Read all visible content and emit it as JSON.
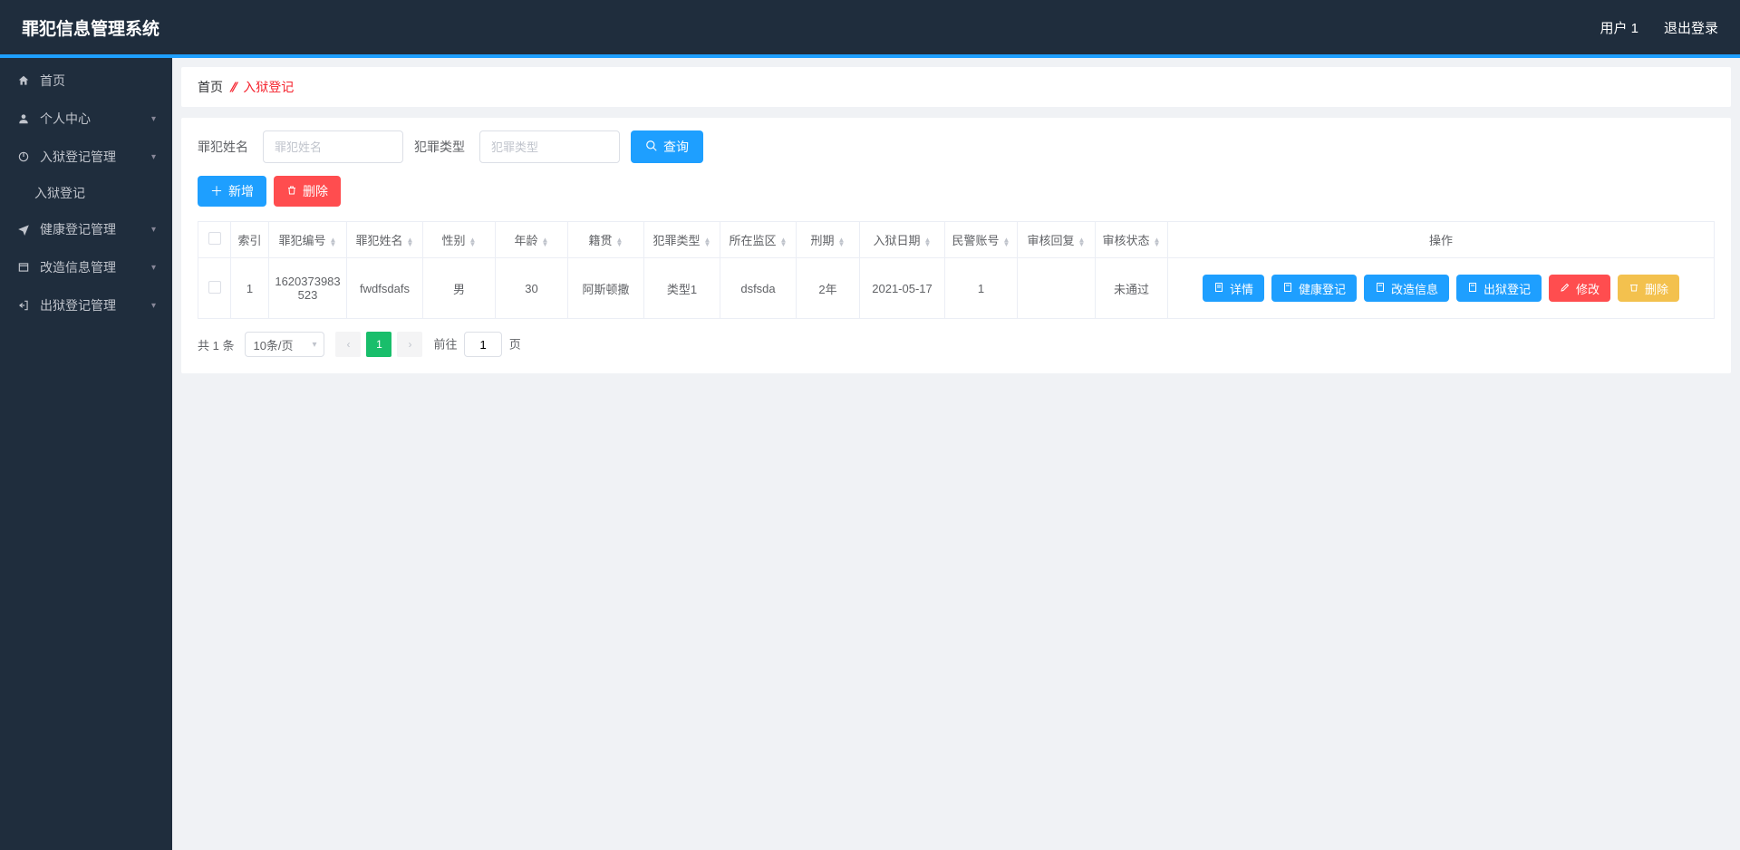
{
  "header": {
    "title": "罪犯信息管理系统",
    "user": "用户 1",
    "logout": "退出登录"
  },
  "sidebar": {
    "items": [
      {
        "icon": "home-icon",
        "label": "首页",
        "expandable": false
      },
      {
        "icon": "user-icon",
        "label": "个人中心",
        "expandable": true
      },
      {
        "icon": "power-icon",
        "label": "入狱登记管理",
        "expandable": true,
        "submenu": [
          "入狱登记"
        ]
      },
      {
        "icon": "plane-icon",
        "label": "健康登记管理",
        "expandable": true
      },
      {
        "icon": "window-icon",
        "label": "改造信息管理",
        "expandable": true
      },
      {
        "icon": "logout-icon",
        "label": "出狱登记管理",
        "expandable": true
      }
    ]
  },
  "breadcrumb": {
    "home": "首页",
    "current": "入狱登记"
  },
  "filters": {
    "name_label": "罪犯姓名",
    "name_placeholder": "罪犯姓名",
    "type_label": "犯罪类型",
    "type_placeholder": "犯罪类型",
    "search_label": "查询"
  },
  "actions": {
    "add_label": "新增",
    "delete_label": "删除"
  },
  "table": {
    "headers": {
      "index": "索引",
      "number": "罪犯编号",
      "name": "罪犯姓名",
      "gender": "性别",
      "age": "年龄",
      "origin": "籍贯",
      "crime_type": "犯罪类型",
      "zone": "所在监区",
      "sentence": "刑期",
      "in_date": "入狱日期",
      "police_account": "民警账号",
      "review_reply": "审核回复",
      "review_status": "审核状态",
      "ops": "操作"
    },
    "rows": [
      {
        "index": "1",
        "number": "1620373983523",
        "name": "fwdfsdafs",
        "gender": "男",
        "age": "30",
        "origin": "阿斯顿撒",
        "crime_type": "类型1",
        "zone": "dsfsda",
        "sentence": "2年",
        "in_date": "2021-05-17",
        "police_account": "1",
        "review_reply": "",
        "review_status": "未通过"
      }
    ],
    "row_actions": {
      "detail": "详情",
      "health": "健康登记",
      "reform": "改造信息",
      "release": "出狱登记",
      "edit": "修改",
      "delete": "删除"
    }
  },
  "pagination": {
    "total_text": "共 1 条",
    "page_size_label": "10条/页",
    "current_page": "1",
    "goto_prefix": "前往",
    "goto_value": "1",
    "goto_suffix": "页"
  }
}
